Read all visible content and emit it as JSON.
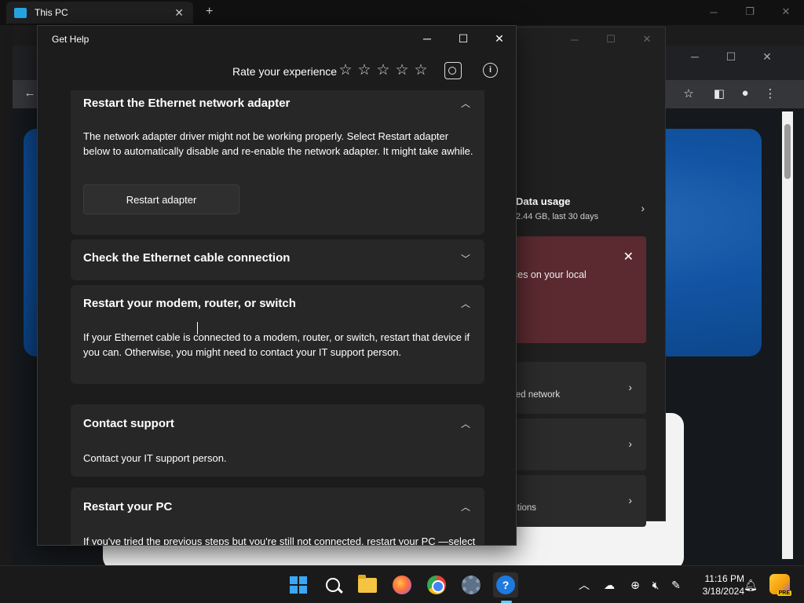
{
  "explorer": {
    "tab_title": "This PC",
    "tab_close": "✕",
    "new_tab": "+",
    "controls": [
      "─",
      "❐",
      "✕"
    ]
  },
  "browser": {
    "controls": [
      "─",
      "☐",
      "✕"
    ],
    "toolbar_icons": [
      "back-icon",
      "star-icon",
      "sidebar-icon",
      "profile-icon",
      "more-icon"
    ]
  },
  "settings": {
    "controls": [
      "─",
      "☐",
      "✕"
    ],
    "data_usage_title": "Data usage",
    "data_usage_sub": "2.44 GB, last 30 days",
    "alert_text": "ces on your local",
    "rows": [
      "red network",
      "",
      "ctions"
    ]
  },
  "gethelp": {
    "title": "Get Help",
    "controls": [
      "─",
      "☐",
      "✕"
    ],
    "rate_label": "Rate your experience",
    "star_count": 5,
    "cards": [
      {
        "heading": "Restart the Ethernet network adapter",
        "expanded": true,
        "body": "The network adapter driver might not be working properly. Select Restart adapter below to automatically disable and re-enable the network adapter. It might take awhile.",
        "button": "Restart adapter"
      },
      {
        "heading": "Check the Ethernet cable connection",
        "expanded": false
      },
      {
        "heading": "Restart your modem, router, or switch",
        "expanded": true,
        "body": "If your Ethernet cable is connected to a modem, router, or switch, restart that device if you can. Otherwise, you might need to contact your IT support person."
      },
      {
        "heading": "Contact support",
        "expanded": true,
        "body": "Contact your IT support person."
      },
      {
        "heading": "Restart your PC",
        "expanded": true,
        "body": "If you've tried the previous steps but you're still not connected, restart your PC —select the Start button > Power > Restart."
      }
    ]
  },
  "taskbar": {
    "apps": [
      "start-icon",
      "search-icon",
      "file-explorer-icon",
      "firefox-icon",
      "chrome-icon",
      "settings-icon",
      "get-help-icon"
    ],
    "time": "11:16 PM",
    "date": "3/18/2024",
    "copilot_badge": "PRE"
  }
}
